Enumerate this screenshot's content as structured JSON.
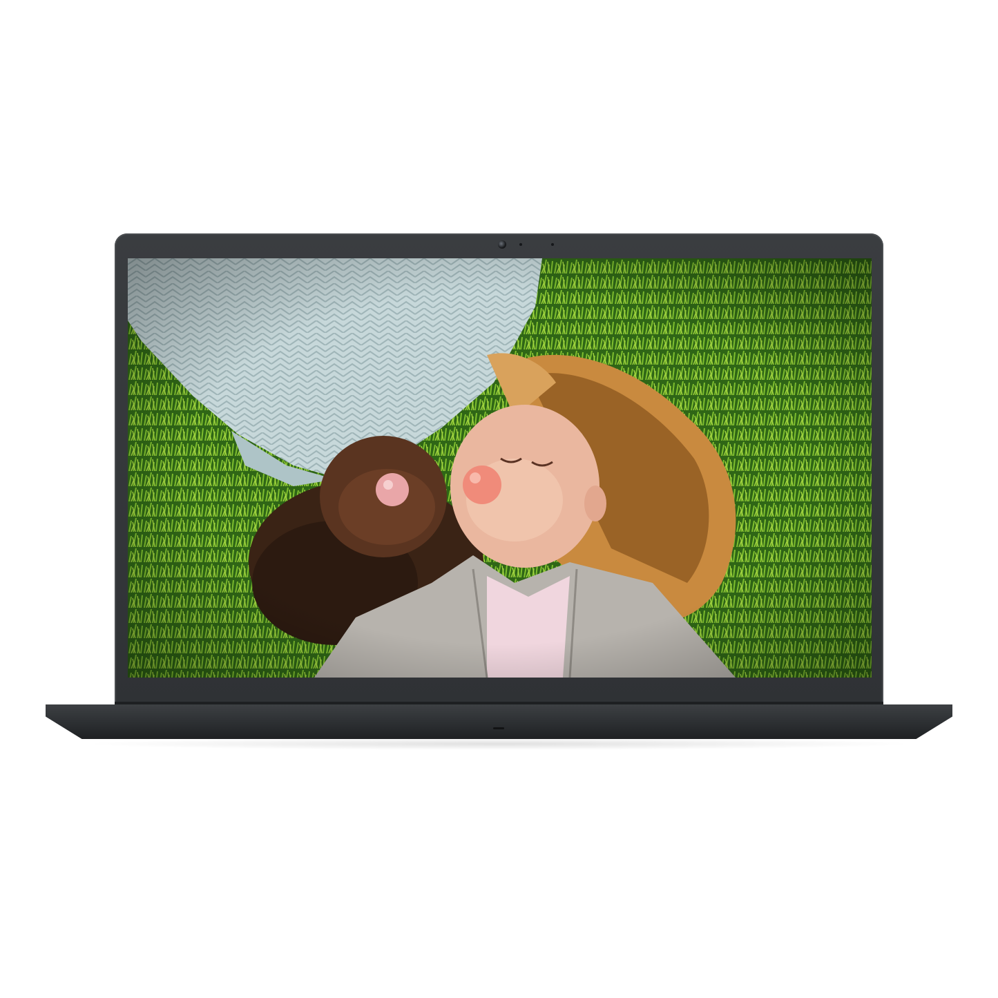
{
  "product": {
    "device": "laptop",
    "color_lid": "#2f3235",
    "color_base": "#2c2f32"
  },
  "screen_image": {
    "icon": "photo-icon",
    "dominant_colors": [
      "#3c7a1c",
      "#c9d6d8",
      "#d9a25c",
      "#e88a82"
    ]
  }
}
